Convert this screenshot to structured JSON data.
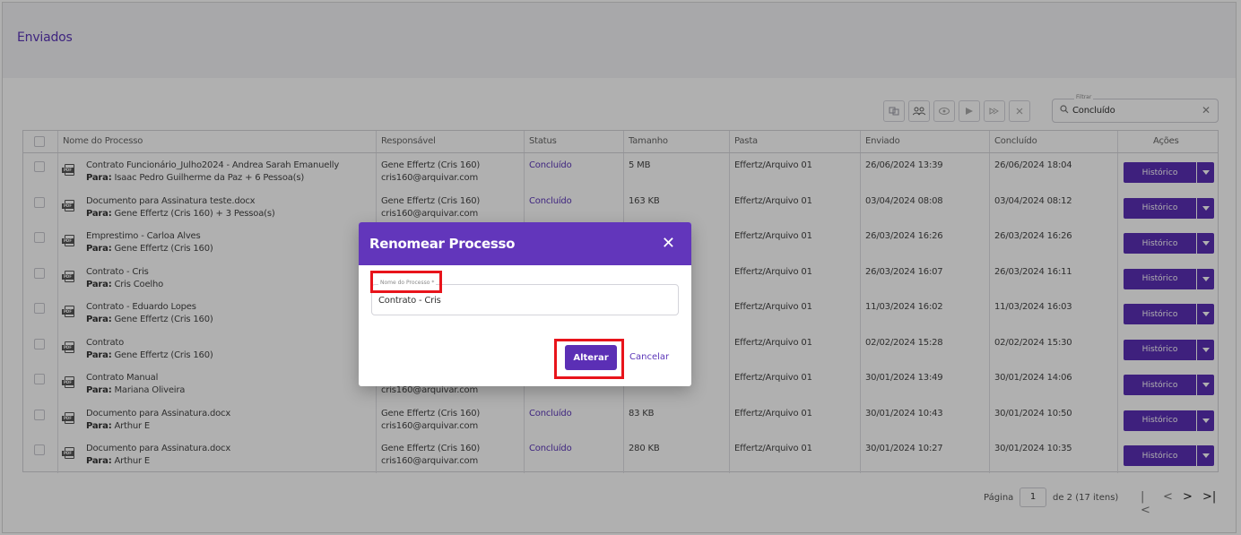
{
  "page": {
    "title": "Enviados"
  },
  "toolbar": {
    "icons": [
      "move-icon",
      "people-icon",
      "eye-icon",
      "send-icon",
      "forward-icon",
      "cancel-icon"
    ]
  },
  "filter": {
    "label": "Filtrar",
    "value": "Concluído",
    "search_icon": "🔍",
    "clear": "✕"
  },
  "table": {
    "headers": [
      "Nome do Processo",
      "Responsável",
      "Status",
      "Tamanho",
      "Pasta",
      "Enviado",
      "Concluído",
      "Ações"
    ],
    "para_label": "Para:",
    "action_label": "Histórico",
    "rows": [
      {
        "name": "Contrato Funcionário_Julho2024 - Andrea Sarah Emanuelly",
        "para": "Isaac Pedro Guilherme da Paz + 6 Pessoa(s)",
        "resp": "Gene Effertz (Cris 160)",
        "email": "cris160@arquivar.com",
        "status": "Concluído",
        "size": "5 MB",
        "folder": "Effertz/Arquivo 01",
        "sent": "26/06/2024 13:39",
        "done": "26/06/2024 18:04"
      },
      {
        "name": "Documento para Assinatura teste.docx",
        "para": "Gene Effertz (Cris 160) + 3 Pessoa(s)",
        "resp": "Gene Effertz (Cris 160)",
        "email": "cris160@arquivar.com",
        "status": "Concluído",
        "size": "163 KB",
        "folder": "Effertz/Arquivo 01",
        "sent": "03/04/2024 08:08",
        "done": "03/04/2024 08:12"
      },
      {
        "name": "Emprestimo - Carloa Alves",
        "para": "Gene Effertz (Cris 160)",
        "resp": "",
        "email": "",
        "status": "",
        "size": "",
        "folder": "Effertz/Arquivo 01",
        "sent": "26/03/2024 16:26",
        "done": "26/03/2024 16:26"
      },
      {
        "name": "Contrato - Cris",
        "para": "Cris Coelho",
        "resp": "",
        "email": "",
        "status": "",
        "size": "",
        "folder": "Effertz/Arquivo 01",
        "sent": "26/03/2024 16:07",
        "done": "26/03/2024 16:11"
      },
      {
        "name": "Contrato - Eduardo Lopes",
        "para": "Gene Effertz (Cris 160)",
        "resp": "",
        "email": "",
        "status": "",
        "size": "",
        "folder": "Effertz/Arquivo 01",
        "sent": "11/03/2024 16:02",
        "done": "11/03/2024 16:03"
      },
      {
        "name": "Contrato",
        "para": "Gene Effertz (Cris 160)",
        "resp": "",
        "email": "",
        "status": "",
        "size": "",
        "folder": "Effertz/Arquivo 01",
        "sent": "02/02/2024 15:28",
        "done": "02/02/2024 15:30"
      },
      {
        "name": "Contrato Manual",
        "para": "Mariana Oliveira",
        "resp": "",
        "email": "cris160@arquivar.com",
        "status": "",
        "size": "",
        "folder": "Effertz/Arquivo 01",
        "sent": "30/01/2024 13:49",
        "done": "30/01/2024 14:06"
      },
      {
        "name": "Documento para Assinatura.docx",
        "para": "Arthur E",
        "resp": "Gene Effertz (Cris 160)",
        "email": "cris160@arquivar.com",
        "status": "Concluído",
        "size": "83 KB",
        "folder": "Effertz/Arquivo 01",
        "sent": "30/01/2024 10:43",
        "done": "30/01/2024 10:50"
      },
      {
        "name": "Documento para Assinatura.docx",
        "para": "Arthur E",
        "resp": "Gene Effertz (Cris 160)",
        "email": "cris160@arquivar.com",
        "status": "Concluído",
        "size": "280 KB",
        "folder": "Effertz/Arquivo 01",
        "sent": "30/01/2024 10:27",
        "done": "30/01/2024 10:35"
      }
    ]
  },
  "pager": {
    "label": "Página",
    "page": "1",
    "info": "de 2 (17 itens)",
    "first": "|<",
    "prev": "<",
    "next": ">",
    "last": ">|"
  },
  "modal": {
    "title": "Renomear Processo",
    "close": "✕",
    "field_label": "Nome do Processo *",
    "field_value": "Contrato - Cris",
    "confirm": "Alterar",
    "cancel": "Cancelar"
  }
}
